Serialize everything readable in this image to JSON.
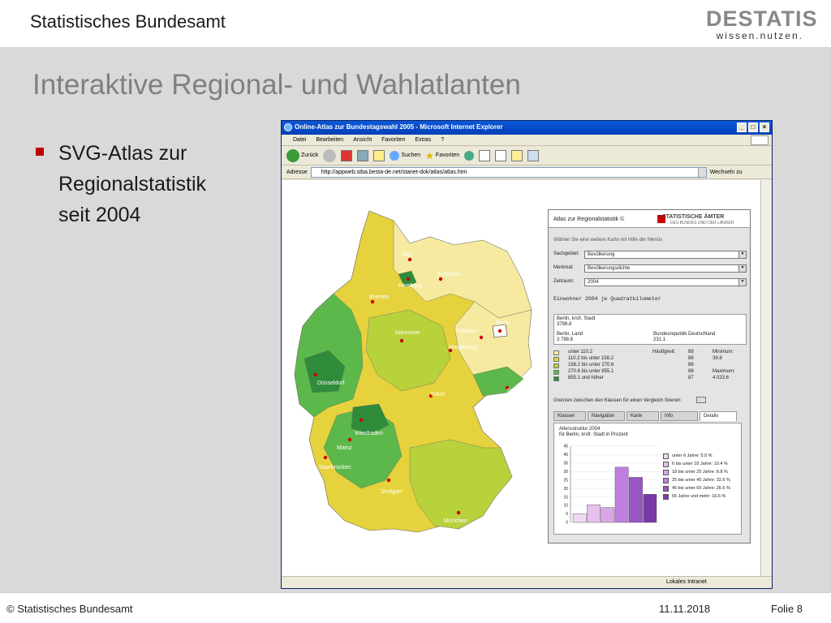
{
  "slide": {
    "organization": "Statistisches Bundesamt",
    "logo_word": "DESTATIS",
    "logo_tagline": "wissen.nutzen.",
    "title": "Interaktive Regional- und  Wahlatlanten",
    "bullet_lines": [
      "SVG-Atlas zur",
      "Regionalstatistik",
      "seit 2004"
    ],
    "footer_copyright": "© Statistisches Bundesamt",
    "footer_date": "11.11.2018",
    "footer_page": "Folie 8"
  },
  "browser": {
    "title": "Online-Atlas zur Bundestagswahl 2005 - Microsoft Internet Explorer",
    "menu": [
      "Datei",
      "Bearbeiten",
      "Ansicht",
      "Favoriten",
      "Extras",
      "?"
    ],
    "toolbar": {
      "back": "Zurück",
      "search": "Suchen",
      "favorites": "Favoriten"
    },
    "address_label": "Adresse",
    "address_url": "http://appweb.stba.besta-de.net/stanet-dok/atlas/atlas.htm",
    "go_label": "Wechseln zu",
    "status_zone": "Lokales Intranet"
  },
  "map": {
    "cities": [
      "Kiel",
      "Hamburg",
      "Schwerin",
      "Bremen",
      "Hannover",
      "Potsdam",
      "Berlin",
      "Magdeburg",
      "Düsseldorf",
      "Erfurt",
      "Dresden",
      "Wiesbaden",
      "Mainz",
      "Saarbrücken",
      "Stuttgart",
      "München"
    ],
    "colors": {
      "c1": "#f5eaa0",
      "c2": "#e6d23c",
      "c3": "#b8d23c",
      "c4": "#5cb84a",
      "c5": "#2e8c3a"
    }
  },
  "atlas": {
    "title": "Atlas zur Regionalstatistik",
    "copyright_mark": "©",
    "org_line1": "STATISTISCHE ÄMTER",
    "org_line2": "DES BUNDES UND DER LÄNDER",
    "hint": "Wählen Sie eine weitere Karte mit Hilfe der Menüs",
    "sachgebiet_label": "Sachgebiet:",
    "sachgebiet_value": "Bevölkerung",
    "merkmal_label": "Merkmal:",
    "merkmal_value": "Bevölkerungsdichte",
    "zeitraum_label": "Zeitraum:",
    "zeitraum_value": "2004",
    "subtitle": "Einwohner 2004 je Quadratkilometer",
    "info": {
      "region": "Berlin, krsfr. Stadt",
      "region_value": "3798.8",
      "land": "Berlin, Land",
      "land_value": "3 798.8",
      "brd": "Bundesrepublik Deutschland",
      "brd_value": "231.1"
    },
    "legend": [
      {
        "label": "unter 110.2",
        "count": "88",
        "color": "#f5eaa0"
      },
      {
        "label": "110.2 bis unter 158.2",
        "count": "88",
        "color": "#e6d23c"
      },
      {
        "label": "158.2 bis unter 270.6",
        "count": "88",
        "color": "#b8d23c"
      },
      {
        "label": "270.6 bis unter 855.1",
        "count": "88",
        "color": "#5cb84a"
      },
      {
        "label": "855.1 und höher",
        "count": "87",
        "color": "#2e8c3a"
      }
    ],
    "haeufigkeit_label": "Häufigkeit:",
    "minimum_label": "Minimum:",
    "minimum_value": "39.8",
    "maximum_label": "Maximum:",
    "maximum_value": "4 023.6",
    "fix_label": "Grenzen zwischen den Klassen für einen Vergleich fixieren:",
    "tabs": [
      "Klassen",
      "Navigation",
      "Karte",
      "Info",
      "Details"
    ],
    "details_title_1": "Altersstruktur 2004",
    "details_title_2": "für Berlin, krsfr. Stadt in Prozent"
  },
  "chart_data": {
    "type": "bar",
    "title": "Altersstruktur 2004",
    "subtitle": "für Berlin, krsfr. Stadt in Prozent",
    "categories": [
      "unter 6 Jahre",
      "6 bis unter 18 Jahre",
      "18 bis unter 25 Jahre",
      "25 bis unter 45 Jahre",
      "45 bis unter 65 Jahre",
      "65 Jahre und mehr"
    ],
    "values": [
      5.0,
      10.4,
      8.8,
      32.6,
      26.6,
      16.6
    ],
    "legend_labels": [
      "unter 6 Jahre: 5.0 %",
      "6 bis unter 18 Jahre: 10.4 %",
      "18 bis unter 25 Jahre: 8.8 %",
      "25 bis unter 45 Jahre: 32.6 %",
      "45 bis unter 65 Jahre: 26.6 %",
      "65 Jahre und mehr: 16.6 %"
    ],
    "colors": [
      "#f0d8f4",
      "#e6c0ee",
      "#d8a6e6",
      "#c07ee0",
      "#9a56c4",
      "#7a3aa6"
    ],
    "yticks": [
      0,
      5,
      10,
      15,
      20,
      25,
      30,
      35,
      40,
      45
    ],
    "ylim": [
      0,
      45
    ],
    "legend_position": "right"
  }
}
